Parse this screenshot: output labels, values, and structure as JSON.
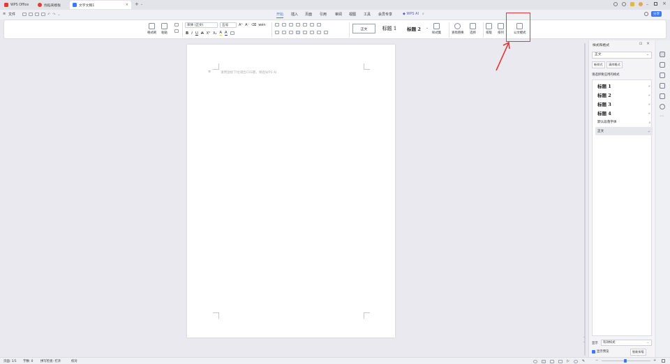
{
  "tabs": [
    {
      "label": "WPS Office",
      "icon": "wps-logo-icon",
      "color": "#e8392e"
    },
    {
      "label": "找稻壳模板",
      "icon": "docer-icon",
      "color": "#e8392e"
    },
    {
      "label": "文字文稿1",
      "icon": "doc-icon",
      "color": "#3a7afe"
    }
  ],
  "tab_add": "+",
  "menubar": {
    "file": "文件",
    "items": [
      "开始",
      "插入",
      "页面",
      "引用",
      "审阅",
      "视图",
      "工具",
      "会员专享"
    ],
    "active": "开始",
    "ai": "WPS AI",
    "share": "分享"
  },
  "ribbon": {
    "format_painter": "格式刷",
    "paste": "粘贴",
    "font_name": "宋体 (正文)",
    "font_size": "五号",
    "bold": "B",
    "italic": "I",
    "underline": "U",
    "styles": {
      "normal": "正文",
      "h1": "标题 1",
      "h2": "标题 2"
    },
    "style_set": "样式集",
    "find_replace": "查找替换",
    "select": "选择",
    "arrange": "排版",
    "sort": "排列",
    "official_doc": "公文模式"
  },
  "document": {
    "placeholder": "请用鼠标下拉调出CSS版，唤起WPS AI"
  },
  "panel": {
    "title": "样式和格式",
    "current": "正文",
    "new_style": "新样式",
    "clear_format": "清除格式",
    "apply_label": "请选择要应用的格式",
    "items": [
      "标题 1",
      "标题 2",
      "标题 3",
      "标题 4",
      "默认段落字体",
      "正文"
    ],
    "show_label": "显示",
    "show_value": "有效样式",
    "preview_label": "显示预览",
    "smart_button": "智能排版"
  },
  "status": {
    "page": "页面: 1/1",
    "words": "字数: 0",
    "spell": "拼写检查: 打开",
    "proof": "校对"
  },
  "colors": {
    "accent": "#3a7afe",
    "annotation": "#e53935"
  }
}
